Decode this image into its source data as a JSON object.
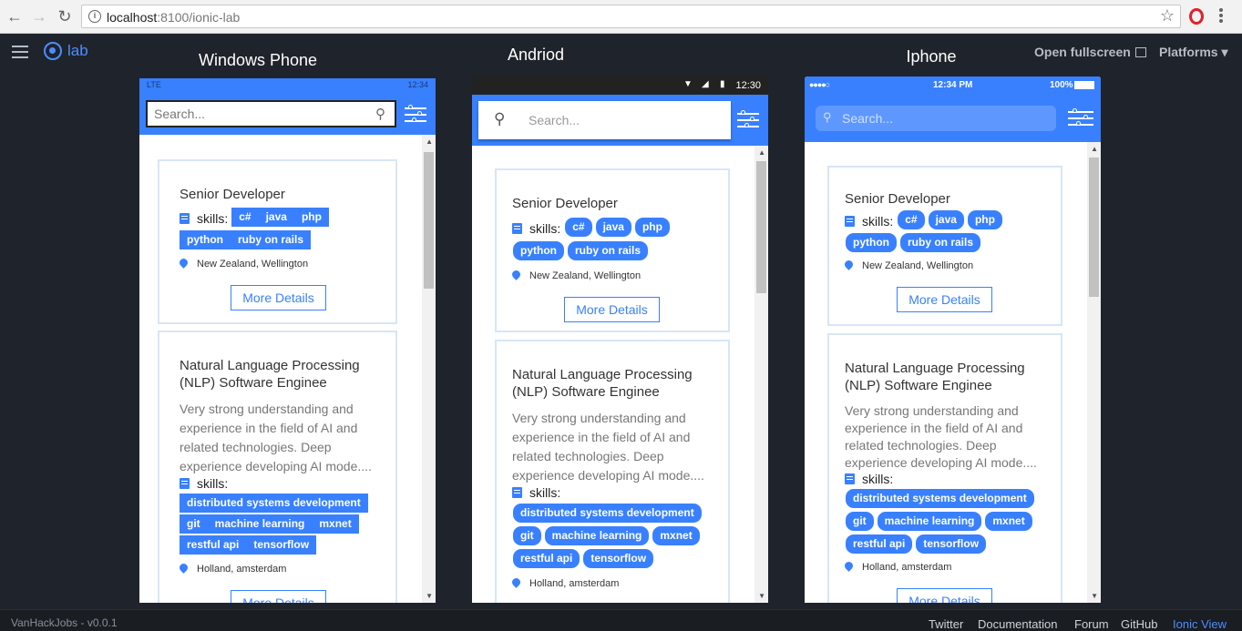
{
  "browser": {
    "url_host": "localhost",
    "url_rest": ":8100/ionic-lab"
  },
  "lab": {
    "logo_text": "lab",
    "open_fullscreen": "Open fullscreen",
    "platforms": "Platforms",
    "version": "VanHackJobs - v0.0.1",
    "footer_links": [
      "Twitter",
      "Documentation",
      "Forum",
      "GitHub",
      "Ionic View"
    ]
  },
  "devices": {
    "windows": {
      "title": "Windows Phone",
      "status_left": "LTE",
      "time": "12:34",
      "search_placeholder": "Search..."
    },
    "android": {
      "title": "Andriod",
      "time": "12:30",
      "search_placeholder": "Search..."
    },
    "iphone": {
      "title": "Iphone",
      "carrier": "●●●●○",
      "time": "12:34 PM",
      "battery": "100%",
      "search_placeholder": "Search..."
    }
  },
  "jobs": [
    {
      "title": "Senior Developer",
      "description": "",
      "skills_label": "skills:",
      "skills_rows": [
        [
          "c#",
          "java",
          "php"
        ],
        [
          "python",
          "ruby on rails"
        ]
      ],
      "location": "New Zealand, Wellington",
      "button": "More Details"
    },
    {
      "title": "Natural Language Processing (NLP) Software Enginee",
      "description": "Very strong understanding and experience in the field of AI and related technologies. Deep experience developing AI mode....",
      "skills_label": "skills:",
      "skills_rows": [
        [
          "distributed systems development"
        ],
        [
          "git",
          "machine learning",
          "mxnet"
        ],
        [
          "restful api",
          "tensorflow"
        ]
      ],
      "location": "Holland, amsterdam",
      "button": "More Details"
    }
  ],
  "colors": {
    "primary": "#3880ff",
    "card_border": "#d7e6f6",
    "lab_bg": "#1f232b"
  }
}
